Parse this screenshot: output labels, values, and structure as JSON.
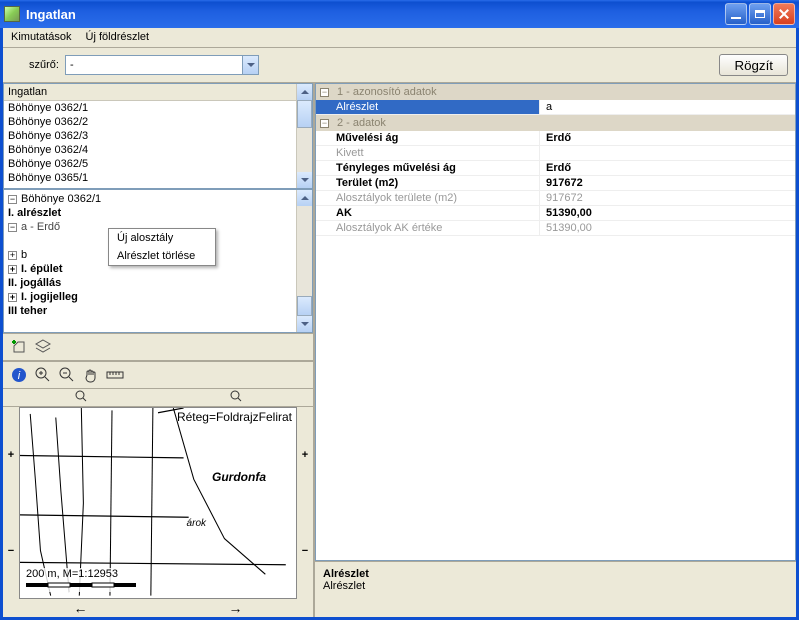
{
  "title": "Ingatlan",
  "menu": {
    "kimutatasok": "Kimutatások",
    "uj_foldreszlet": "Új földrészlet"
  },
  "filter": {
    "label": "szűrő:",
    "value": "-",
    "save_btn": "Rögzít"
  },
  "list": {
    "header": "Ingatlan",
    "rows": [
      "Böhönye 0362/1",
      "Böhönye 0362/2",
      "Böhönye 0362/3",
      "Böhönye 0362/4",
      "Böhönye 0362/5",
      "Böhönye 0365/1"
    ]
  },
  "tree": {
    "root": "Böhönye 0362/1",
    "alreszlet": "I. alrészlet",
    "a": "a - Erdő",
    "b": "b",
    "epulet": "I. épület",
    "jogallas": "II. jogállás",
    "jogijelleg": "I. jogijelleg",
    "teher": "III teher"
  },
  "context_menu": {
    "uj_alosztaly": "Új alosztály",
    "torles": "Alrészlet törlése"
  },
  "pgrid": {
    "cat1": "1 - azonosító adatok",
    "cat2": "2 - adatok",
    "rows": [
      {
        "k": "Alrészlet",
        "v": "a",
        "sel": true
      },
      {
        "k": "Művelési ág",
        "v": "Erdő",
        "bold": true
      },
      {
        "k": "Kivett",
        "v": "",
        "dim": true
      },
      {
        "k": "Tényleges művelési ág",
        "v": "Erdő",
        "bold": true
      },
      {
        "k": "Terület (m2)",
        "v": "917672",
        "bold": true
      },
      {
        "k": "Alosztályok területe (m2)",
        "v": "917672",
        "dim": true
      },
      {
        "k": "AK",
        "v": "51390,00",
        "bold": true
      },
      {
        "k": "Alosztályok AK értéke",
        "v": "51390,00",
        "dim": true
      }
    ]
  },
  "desc": {
    "title": "Alrészlet",
    "body": "Alrészlet"
  },
  "map": {
    "layer": "Réteg=FoldrajzFelirat",
    "place": "Gurdonfa",
    "feature": "árok",
    "scale": "200 m, M=1:12953"
  }
}
